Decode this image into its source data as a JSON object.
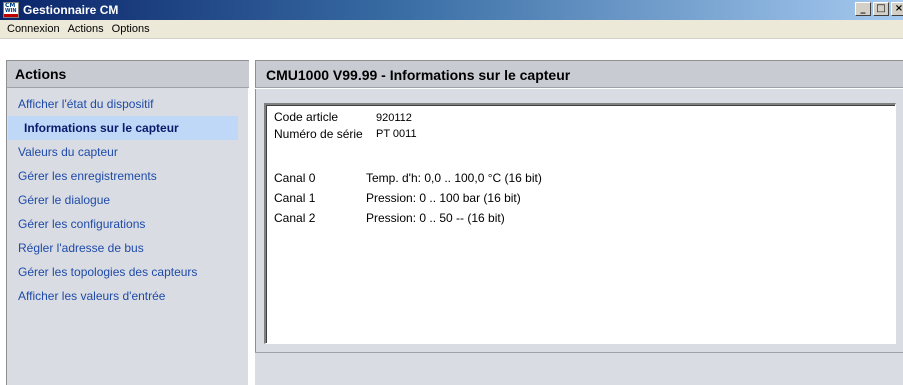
{
  "window": {
    "title": "Gestionnaire CM",
    "icon": "cm-win-app-icon",
    "buttons": [
      "_",
      "□",
      "×"
    ]
  },
  "menu": [
    "Connexion",
    "Actions",
    "Options"
  ],
  "sidebar": {
    "title": "Actions",
    "items": [
      {
        "label": "Afficher l'état du dispositif",
        "selected": false
      },
      {
        "label": "Informations sur le capteur",
        "selected": true
      },
      {
        "label": "Valeurs du capteur",
        "selected": false
      },
      {
        "label": "Gérer les enregistrements",
        "selected": false
      },
      {
        "label": "Gérer le dialogue",
        "selected": false
      },
      {
        "label": "Gérer les configurations",
        "selected": false
      },
      {
        "label": "Régler l'adresse de bus",
        "selected": false
      },
      {
        "label": "Gérer les topologies des capteurs",
        "selected": false
      },
      {
        "label": "Afficher les valeurs d'entrée",
        "selected": false
      }
    ]
  },
  "main": {
    "title": "CMU1000 V99.99 - Informations sur le capteur",
    "fields": [
      {
        "label": "Code article",
        "value": "920112"
      },
      {
        "label": "Numéro de série",
        "value": "PT 0011"
      }
    ],
    "channels": [
      {
        "label": "Canal 0",
        "value": "Temp. d'h: 0,0 .. 100,0 °C (16 bit)"
      },
      {
        "label": "Canal 1",
        "value": "Pression: 0 .. 100 bar (16 bit)"
      },
      {
        "label": "Canal 2",
        "value": "Pression: 0 .. 50 -- (16 bit)"
      }
    ]
  },
  "colors": {
    "titlebar_start": "#0a246a",
    "titlebar_end": "#a6caf0",
    "panel_bg": "#d9dde3",
    "selected_bg": "#c0d8f8",
    "link_text": "#1f4aa8"
  }
}
